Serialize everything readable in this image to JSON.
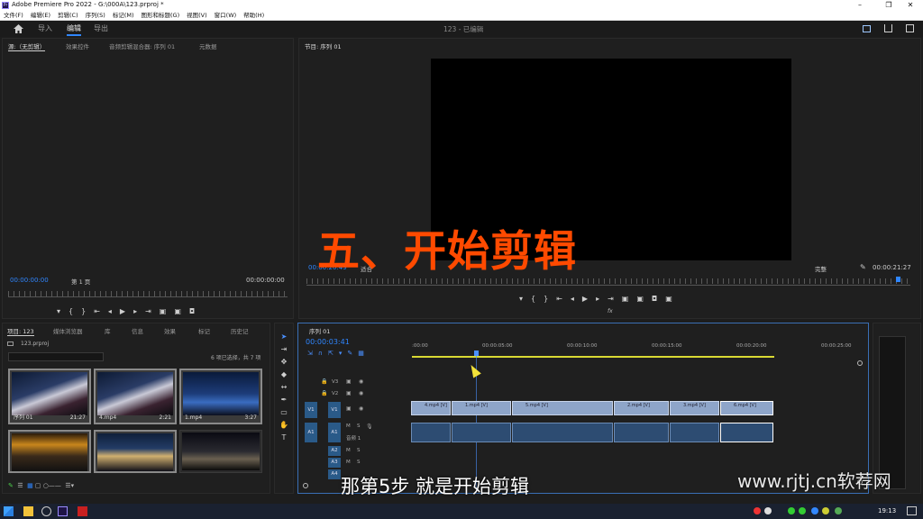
{
  "app": {
    "title": "Adobe Premiere Pro 2022 - G:\\000A\\123.prproj *",
    "logo_text": "Pr",
    "window_controls": [
      "–",
      "❐",
      "✕"
    ]
  },
  "menu": [
    "文件(F)",
    "编辑(E)",
    "剪辑(C)",
    "序列(S)",
    "标记(M)",
    "图形和标题(G)",
    "视图(V)",
    "窗口(W)",
    "帮助(H)"
  ],
  "workspace": {
    "tabs": [
      "导入",
      "编辑",
      "导出"
    ],
    "active_tab": "编辑",
    "project_status": "123 - 已编辑"
  },
  "source_panel": {
    "tabs": [
      "源:（无剪辑）",
      "效果控件",
      "音频剪辑混合器: 序列 01",
      "元数据"
    ],
    "timecode_in": "00:00:00:00",
    "page_select": "第 1 页",
    "timecode_out": "00:00:00:00"
  },
  "program_panel": {
    "title": "节目: 序列 01",
    "timecode": "00:00:20:49",
    "fit": "适合",
    "quality": "完整",
    "duration": "00:00:21:27",
    "fx": "fx"
  },
  "project_panel": {
    "tabs": [
      "项目: 123",
      "媒体浏览器",
      "库",
      "信息",
      "效果",
      "标记",
      "历史记"
    ],
    "file": "123.prproj",
    "selection_info": "6 项已选择，共 7 项",
    "search_placeholder": "",
    "items": [
      {
        "name": "序列 01",
        "duration": "21:27"
      },
      {
        "name": "4.mp4",
        "duration": "2:21"
      },
      {
        "name": "1.mp4",
        "duration": "3:27"
      },
      {
        "name": "",
        "duration": ""
      },
      {
        "name": "",
        "duration": ""
      },
      {
        "name": "",
        "duration": ""
      }
    ]
  },
  "timeline": {
    "tab": "序列 01",
    "timecode": "00:00:03:41",
    "ruler_labels": [
      ":00:00",
      "00:00:05:00",
      "00:00:10:00",
      "00:00:15:00",
      "00:00:20:00",
      "00:00:25:00"
    ],
    "video_tracks": [
      "V3",
      "V2",
      "V1"
    ],
    "audio_tracks": [
      "A1",
      "A2",
      "A3",
      "A4"
    ],
    "src_v": "V1",
    "src_a": "A1",
    "audio_label": "音频 1",
    "clips": [
      "4.mp4 [V]",
      "1.mp4 [V]",
      "5.mp4 [V]",
      "2.mp4 [V]",
      "3.mp4 [V]",
      "6.mp4 [V]"
    ]
  },
  "overlay": {
    "heading": "五、开始剪辑",
    "subtitle": "那第5步  就是开始剪辑",
    "watermark": "www.rjtj.cn软荐网"
  },
  "taskbar": {
    "clock": "19:13"
  },
  "colors": {
    "accent": "#2f86ff",
    "heading": "#ff4a00",
    "clip_video": "#8ea5c9",
    "clip_audio": "#2d4c72"
  }
}
